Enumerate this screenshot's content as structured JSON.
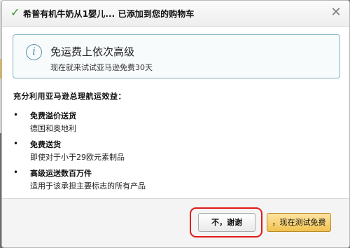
{
  "dialog": {
    "title": "希普有机牛奶从1婴儿... 已添加到您的购物车",
    "close_symbol": "✕"
  },
  "notice": {
    "icon": "info-icon",
    "title": "免运费上依次高级",
    "subtitle": "现在就来试试亚马逊免费30天"
  },
  "benefits": {
    "heading": "充分利用亚马逊总理航运效益：",
    "items": [
      {
        "title": "免费溢价送货",
        "desc": "德国和奥地利"
      },
      {
        "title": "免费送货",
        "desc": "即使对于小于29欧元素制品"
      },
      {
        "title": "高级运送数百万件",
        "desc": "适用于该承担主要标志的所有产品"
      }
    ]
  },
  "buttons": {
    "no_thanks": "不，谢谢",
    "try_free": "，现在测试免费"
  },
  "colors": {
    "highlight": "#e11919",
    "primary_button": "#f1c24f",
    "notice_border": "#7fb3bd"
  }
}
